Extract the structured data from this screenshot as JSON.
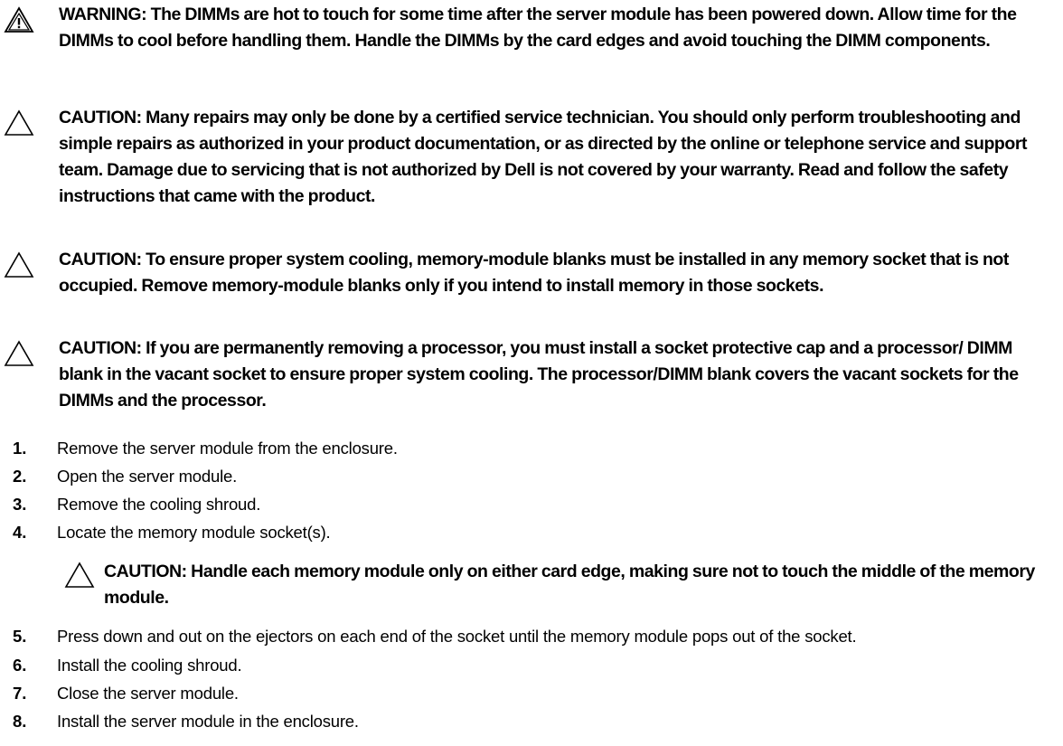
{
  "notices": [
    {
      "kind": "warning",
      "icon": "warning-triangle-icon",
      "text": "WARNING: The DIMMs are hot to touch for some time after the server module has been powered down. Allow time for the DIMMs to cool before handling them. Handle the DIMMs by the card edges and avoid touching the DIMM components."
    },
    {
      "kind": "caution",
      "icon": "caution-triangle-icon",
      "text": "CAUTION: Many repairs may only be done by a certified service technician. You should only perform troubleshooting and simple repairs as authorized in your product documentation, or as directed by the online or telephone service and support team. Damage due to servicing that is not authorized by Dell is not covered by your warranty. Read and follow the safety instructions that came with the product."
    },
    {
      "kind": "caution",
      "icon": "caution-triangle-icon",
      "text": "CAUTION: To ensure proper system cooling, memory-module blanks must be installed in any memory socket that is not occupied. Remove memory-module blanks only if you intend to install memory in those sockets."
    },
    {
      "kind": "caution",
      "icon": "caution-triangle-icon",
      "text": "CAUTION: If you are permanently removing a processor, you must install a socket protective cap and a processor/ DIMM blank in the vacant socket to ensure proper system cooling. The processor/DIMM blank covers the vacant sockets for the DIMMs and the processor."
    }
  ],
  "steps": [
    {
      "number": "1.",
      "text": "Remove the server module from the enclosure."
    },
    {
      "number": "2.",
      "text": "Open the server module."
    },
    {
      "number": "3.",
      "text": "Remove the cooling shroud."
    },
    {
      "number": "4.",
      "text": "Locate the memory module socket(s)."
    },
    {
      "number": "5.",
      "text": "Press down and out on the ejectors on each end of the socket until the memory module pops out of the socket."
    },
    {
      "number": "6.",
      "text": "Install the cooling shroud."
    },
    {
      "number": "7.",
      "text": "Close the server module."
    },
    {
      "number": "8.",
      "text": "Install the server module in the enclosure."
    }
  ],
  "step_caution": {
    "icon": "caution-triangle-icon",
    "text": "CAUTION: Handle each memory module only on either card edge, making sure not to touch the middle of the memory module."
  }
}
